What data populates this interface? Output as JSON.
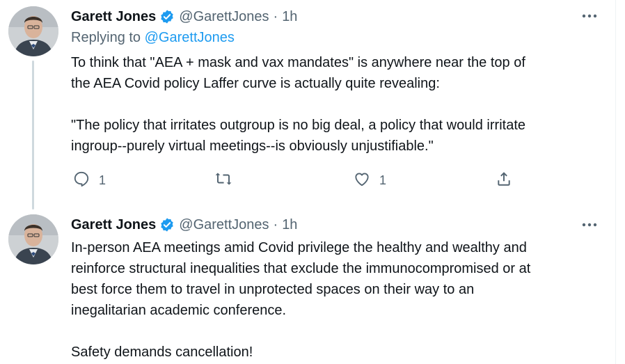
{
  "tweets": [
    {
      "author_name": "Garett Jones",
      "handle": "@GarettJones",
      "separator": "·",
      "time": "1h",
      "replying_prefix": "Replying to",
      "replying_handle": "@GarettJones",
      "paragraphs": [
        "To think that \"AEA + mask and vax mandates\" is anywhere near the top of\nthe AEA Covid policy Laffer curve is actually quite revealing:",
        "\"The policy that irritates outgroup is no big deal, a policy that would irritate\ningroup--purely virtual meetings--is obviously unjustifiable.\""
      ],
      "reply_count": "1",
      "retweet_count": "",
      "like_count": "1",
      "icons": [
        "reply-icon",
        "retweet-icon",
        "like-icon",
        "share-icon",
        "more-icon",
        "verified-badge-icon"
      ]
    },
    {
      "author_name": "Garett Jones",
      "handle": "@GarettJones",
      "separator": "·",
      "time": "1h",
      "paragraphs": [
        "In-person AEA meetings amid Covid privilege the healthy and wealthy and\nreinforce structural inequalities that exclude the immunocompromised or at\nbest force them to travel in unprotected spaces on their way to an\ninegalitarian academic conference.",
        "Safety demands cancellation!"
      ]
    }
  ],
  "colors": {
    "text": "#0f1419",
    "secondary": "#536471",
    "accent": "#1d9bf0",
    "thread_line": "#cfd9de"
  }
}
